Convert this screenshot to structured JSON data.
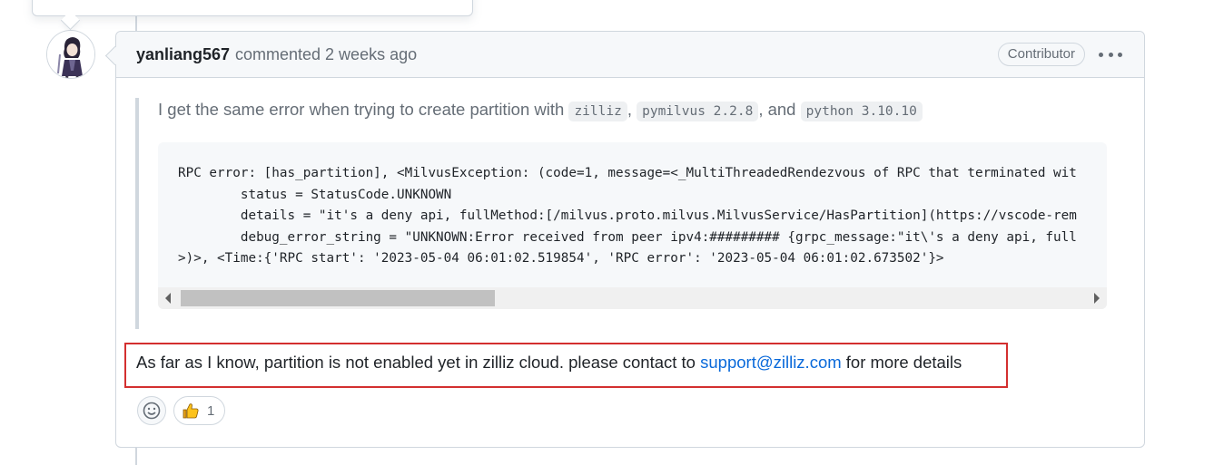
{
  "comment": {
    "author": "yanliang567",
    "action_time": "commented 2 weeks ago",
    "badge": "Contributor",
    "menu_icon": "kebab-horizontal-icon",
    "avatar_icon": "anime-character-avatar"
  },
  "quote": {
    "text_before": "I get the same error when trying to create partition with ",
    "code1": "zilliz",
    "sep1": ", ",
    "code2": "pymilvus 2.2.8",
    "sep2": ", and ",
    "code3": "python 3.10.10",
    "code_lines": [
      "RPC error: [has_partition], <MilvusException: (code=1, message=<_MultiThreadedRendezvous of RPC that terminated wit",
      "        status = StatusCode.UNKNOWN",
      "        details = \"it's a deny api, fullMethod:[/milvus.proto.milvus.MilvusService/HasPartition](https://vscode-rem",
      "        debug_error_string = \"UNKNOWN:Error received from peer ipv4:######### {grpc_message:\"it\\'s a deny api, full",
      ">)>, <Time:{'RPC start': '2023-05-04 06:01:02.519854', 'RPC error': '2023-05-04 06:01:02.673502'}>"
    ]
  },
  "reply": {
    "text_before": "As far as I know, partition is not enabled yet in zilliz cloud. please contact to ",
    "link": "support@zilliz.com",
    "text_after": " for more details"
  },
  "reactions": {
    "emoji_picker_icon": "smiley-icon",
    "thumbs_up_icon": "thumbs-up-icon",
    "thumbs_up_count": "1"
  },
  "colors": {
    "link": "#0969da",
    "highlight_border": "#d32f2f",
    "muted_text": "#656d76"
  }
}
